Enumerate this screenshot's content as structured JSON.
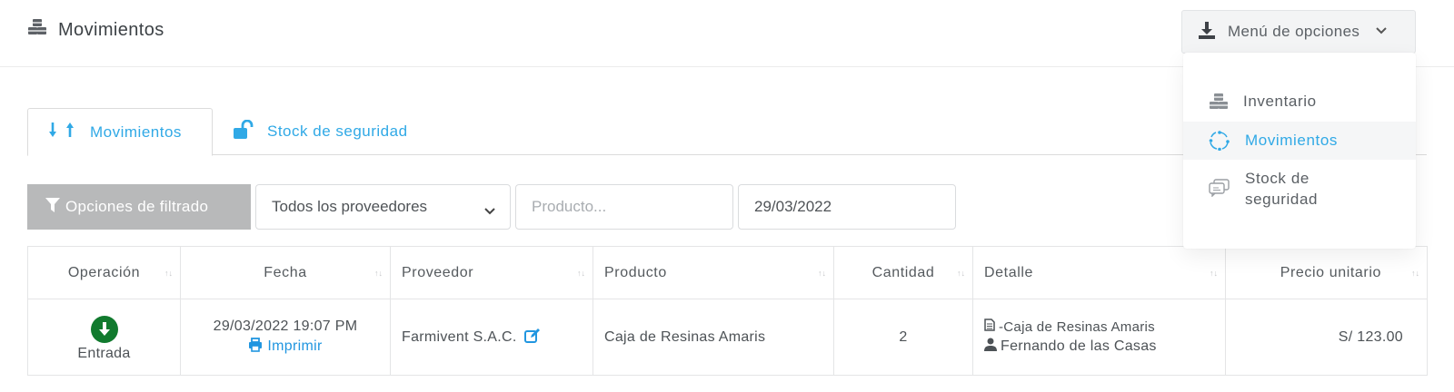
{
  "header": {
    "title": "Movimientos",
    "title_icon": "cubes-icon",
    "options_label": "Menú de opciones",
    "options_icon": "download-icon"
  },
  "dropdown": {
    "items": [
      {
        "label": "Inventario",
        "icon": "cubes-icon"
      },
      {
        "label": "Movimientos",
        "icon": "cycle-icon",
        "active": true
      },
      {
        "label": "Stock de",
        "label2": "seguridad",
        "icon": "chat-icon"
      }
    ]
  },
  "tabs": [
    {
      "label": "Movimientos",
      "icon": "arrows-updown-icon",
      "active": true
    },
    {
      "label": "Stock de seguridad",
      "icon": "unlock-icon"
    }
  ],
  "filters": {
    "button_label": "Opciones de filtrado",
    "provider_value": "Todos los proveedores",
    "product_placeholder": "Producto...",
    "date_value": "29/03/2022"
  },
  "table": {
    "headers": [
      "Operación",
      "Fecha",
      "Proveedor",
      "Producto",
      "Cantidad",
      "Detalle",
      "Precio unitario"
    ],
    "rows": [
      {
        "operacion": "Entrada",
        "fecha": "29/03/2022 19:07 PM",
        "imprimir": "Imprimir",
        "proveedor": "Farmivent S.A.C.",
        "producto": "Caja de Resinas Amaris",
        "cantidad": "2",
        "detalle_producto": "-Caja de Resinas Amaris",
        "detalle_usuario": "Fernando de las Casas",
        "precio": "S/ 123.00"
      }
    ]
  },
  "colors": {
    "accent": "#30a9e6",
    "link": "#2196e0",
    "entrada": "#117a2e",
    "filter_button": "#b8b9ba"
  }
}
